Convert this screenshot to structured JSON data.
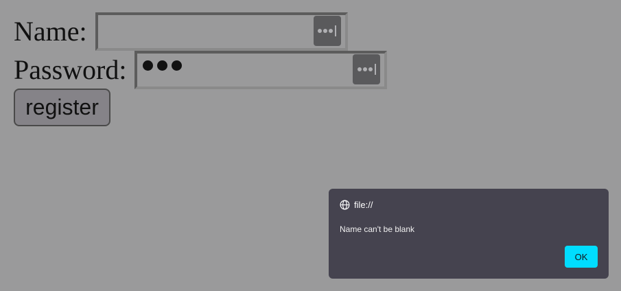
{
  "form": {
    "name_label": "Name:",
    "name_value": "",
    "password_label": "Password:",
    "password_masked_length": 3,
    "register_label": "register"
  },
  "dialog": {
    "origin": "file://",
    "message": "Name can't be blank",
    "ok_label": "OK",
    "accent_color": "#00ddff",
    "background_color": "#45434f"
  },
  "page": {
    "overlay_color": "#9a9a9b"
  },
  "icons": {
    "password_manager": "password-manager-icon",
    "origin": "globe-icon"
  }
}
